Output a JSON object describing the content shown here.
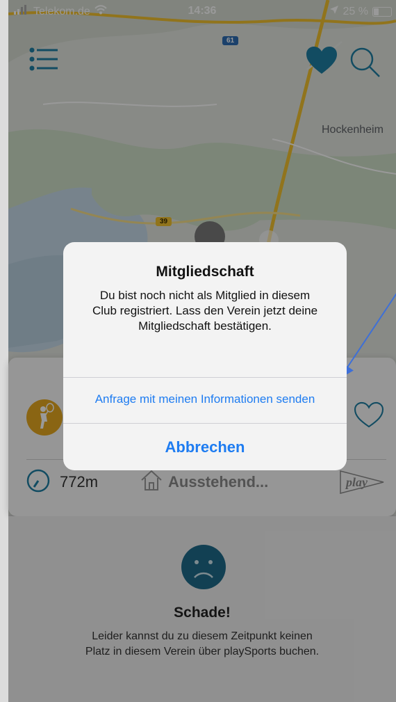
{
  "status_bar": {
    "carrier": "Telekom.de",
    "time": "14:36",
    "battery": "25 %",
    "battery_level": 0.25
  },
  "map": {
    "labels": {
      "city": "Hockenheim",
      "road_61": "61",
      "road_39": "39",
      "road_61_small": "61"
    }
  },
  "icons": {
    "menu": "menu-icon",
    "favorite": "heart-icon",
    "search": "search-icon"
  },
  "club_card": {
    "distance": "772m",
    "status": "Ausstehend...",
    "logo": "play"
  },
  "no_booking": {
    "title": "Schade!",
    "message": "Leider kannst du zu diesem Zeitpunkt keinen Platz in diesem Verein über playSports buchen."
  },
  "alert": {
    "title": "Mitgliedschaft",
    "message": "Du bist noch nicht als Mitglied in diesem Club registriert. Lass den Verein jetzt deine Mitgliedschaft bestätigen.",
    "action_label": "Anfrage mit meinen Informationen senden",
    "cancel_label": "Abbrechen"
  },
  "colors": {
    "accent": "#1e7cf1",
    "brand_teal": "#1f7fa3",
    "club_orange": "#e6a920"
  }
}
